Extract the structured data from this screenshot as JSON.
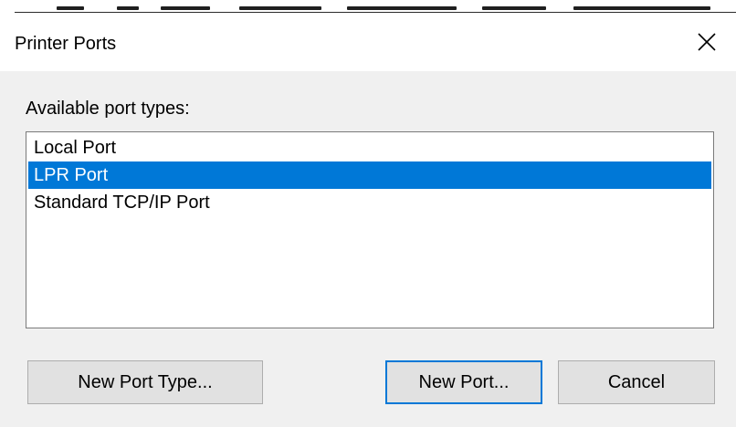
{
  "dialog": {
    "title": "Printer Ports",
    "close_icon": "close-icon",
    "group_label": "Available port types:",
    "port_types": [
      {
        "label": "Local Port",
        "selected": false
      },
      {
        "label": "LPR Port",
        "selected": true
      },
      {
        "label": "Standard TCP/IP Port",
        "selected": false
      }
    ],
    "buttons": {
      "new_port_type": "New Port Type...",
      "new_port": "New Port...",
      "cancel": "Cancel"
    }
  },
  "colors": {
    "selection": "#0078d7",
    "client_background": "#f0f0f0",
    "button_face": "#e1e1e1",
    "button_border": "#adadad",
    "default_button_border": "#0078d7"
  }
}
